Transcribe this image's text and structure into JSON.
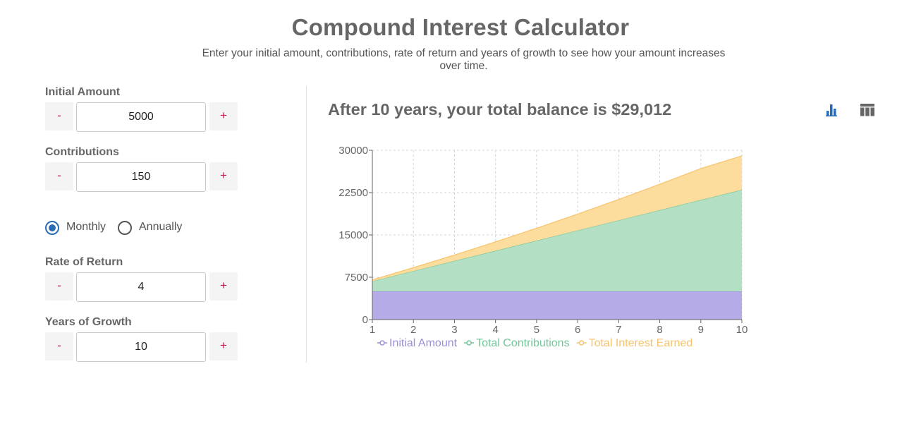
{
  "header": {
    "title": "Compound Interest Calculator",
    "subtitle": "Enter your initial amount, contributions, rate of return and years of growth to see how your amount increases over time."
  },
  "form": {
    "initial_amount": {
      "label": "Initial Amount",
      "value": "5000",
      "minus": "-",
      "plus": "+"
    },
    "contributions": {
      "label": "Contributions",
      "value": "150",
      "minus": "-",
      "plus": "+"
    },
    "frequency": {
      "options": [
        "Monthly",
        "Annually"
      ],
      "selected": "Monthly"
    },
    "rate_of_return": {
      "label": "Rate of Return",
      "value": "4",
      "minus": "-",
      "plus": "+"
    },
    "years_of_growth": {
      "label": "Years of Growth",
      "value": "10",
      "minus": "-",
      "plus": "+"
    }
  },
  "result": {
    "title": "After 10 years, your total balance is $29,012",
    "icons": [
      "bar-chart-icon",
      "table-icon"
    ]
  },
  "colors": {
    "accent": "#2a6bb8",
    "stepper_text": "#c2185b",
    "initial": "#9b8fd6",
    "initial_fill": "#b5abe6",
    "contributions": "#72c599",
    "contributions_fill": "#b3e0c4",
    "interest": "#f5c36b",
    "interest_fill": "#fddd9d"
  },
  "chart_data": {
    "type": "area",
    "stacked": true,
    "x": [
      1,
      2,
      3,
      4,
      5,
      6,
      7,
      8,
      9,
      10
    ],
    "ylim": [
      0,
      30000
    ],
    "yticks": [
      0,
      7500,
      15000,
      22500,
      30000
    ],
    "grid": true,
    "legend_position": "bottom",
    "series": [
      {
        "name": "Initial Amount",
        "color": "#9b8fd6",
        "fill": "#b5abe6",
        "values": [
          5000,
          5000,
          5000,
          5000,
          5000,
          5000,
          5000,
          5000,
          5000,
          5000
        ]
      },
      {
        "name": "Total Contributions",
        "color": "#72c599",
        "fill": "#b3e0c4",
        "values": [
          1800,
          3600,
          5400,
          7200,
          9000,
          10800,
          12600,
          14400,
          16200,
          18000
        ]
      },
      {
        "name": "Total Interest Earned",
        "color": "#f5c36b",
        "fill": "#fddd9d",
        "values": [
          238,
          605,
          1048,
          1576,
          2190,
          2892,
          3687,
          4576,
          5560,
          6012
        ]
      }
    ]
  }
}
